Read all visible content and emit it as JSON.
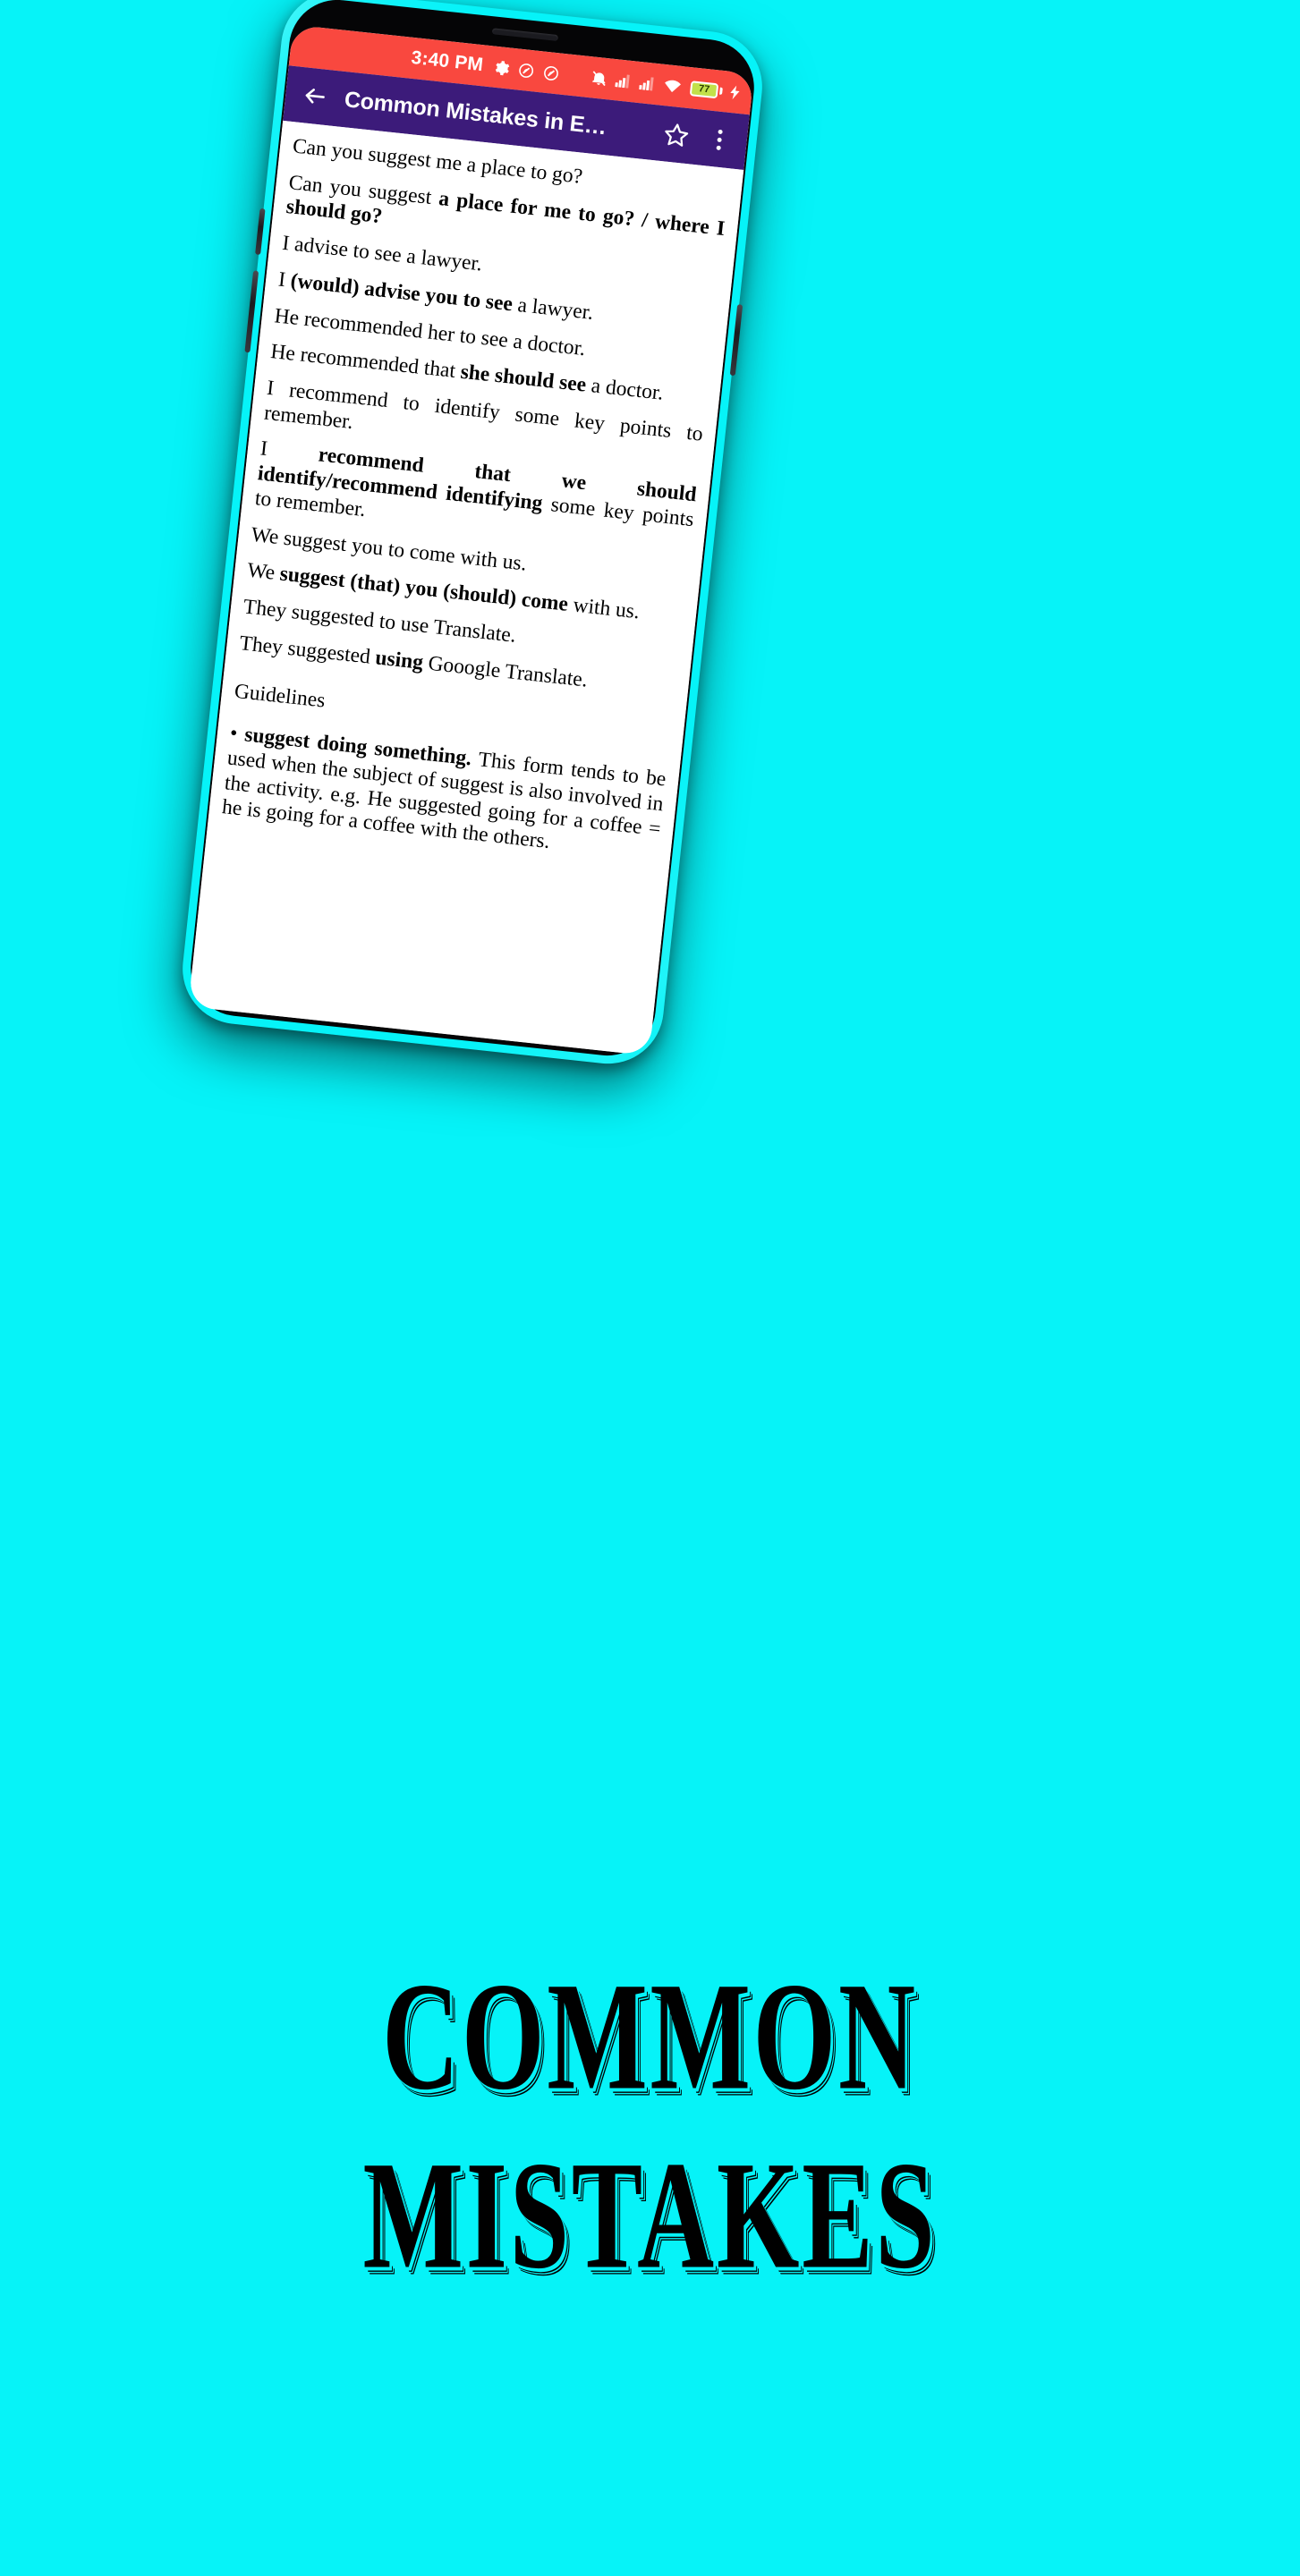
{
  "background_color": "#06f3f8",
  "statusbar": {
    "background_color": "#f9483f",
    "time": "3:40 PM",
    "icons": [
      "gear-icon",
      "do-not-disturb-icon",
      "do-not-disturb-icon",
      "alarm-off-icon",
      "signal-bars-icon",
      "signal-bars-icon",
      "wifi-icon",
      "battery-icon"
    ],
    "battery_percent": "77",
    "battery_charging": true
  },
  "appbar": {
    "background_color": "#3c1b7a",
    "back_label": "back-arrow",
    "title": "Common Mistakes in E…",
    "star_label": "favorite",
    "menu_label": "more-options"
  },
  "content": {
    "lines": [
      {
        "id": "l1",
        "type": "wrong",
        "html": "Can you suggest me a place to go?"
      },
      {
        "id": "l2",
        "type": "correct",
        "html": "Can you suggest <b>a place for me to go? / where I should go?</b>"
      },
      {
        "id": "l3",
        "type": "wrong",
        "html": "I advise to see a lawyer."
      },
      {
        "id": "l4",
        "type": "correct",
        "html": "I <b>(would) advise you to see</b> a lawyer."
      },
      {
        "id": "l5",
        "type": "wrong",
        "html": "He recommended her to see a doctor."
      },
      {
        "id": "l6",
        "type": "correct",
        "html": "He recommended that <b>she should see</b> a doctor."
      },
      {
        "id": "l7",
        "type": "wrong",
        "html": "I recommend to identify some key points to remember."
      },
      {
        "id": "l8",
        "type": "correct",
        "html": "I <b>recommend that we should identify/recommend identifying</b> some key points to remember."
      },
      {
        "id": "l9",
        "type": "wrong",
        "html": "We suggest you to come with us."
      },
      {
        "id": "l10",
        "type": "correct",
        "html": "We <b>suggest (that) you (should) come</b> with us."
      },
      {
        "id": "l11",
        "type": "wrong",
        "html": "They suggested to use Translate."
      },
      {
        "id": "l12",
        "type": "correct",
        "html": "They suggested <b>using</b> Gooogle Translate."
      },
      {
        "id": "l13",
        "type": "heading",
        "html": "Guidelines"
      },
      {
        "id": "l14",
        "type": "bullet",
        "html": "• <b>suggest doing something.</b> This form tends to be used when the subject of suggest is also involved in the activity. e.g. He suggested going for a coffee = he is going for a coffee with the others."
      }
    ]
  },
  "promo": {
    "line1": "COMMON",
    "line2": "MISTAKES"
  }
}
